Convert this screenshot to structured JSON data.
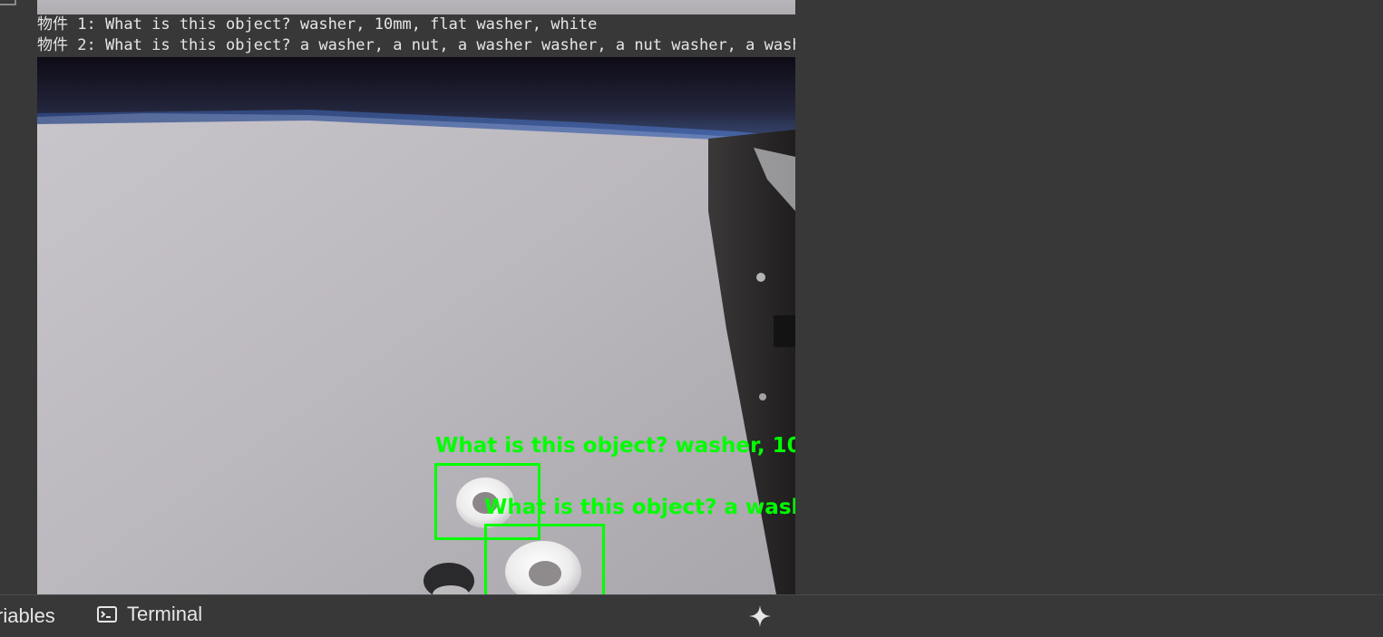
{
  "output": {
    "lines": [
      "物件 1: What is this object? washer, 10mm, flat washer, white",
      "物件 2: What is this object? a washer, a nut, a washer washer, a nut washer, a washer washer, a washer washer, a was"
    ],
    "detections": [
      {
        "label": "What is this object? washer, 10"
      },
      {
        "label": "What is this object? a wash"
      }
    ],
    "box_color": "#00ff00"
  },
  "bottom_bar": {
    "variables_label": "riables",
    "terminal_label": "Terminal",
    "terminal_icon": "terminal-icon",
    "gemini_icon": "sparkle-icon"
  }
}
